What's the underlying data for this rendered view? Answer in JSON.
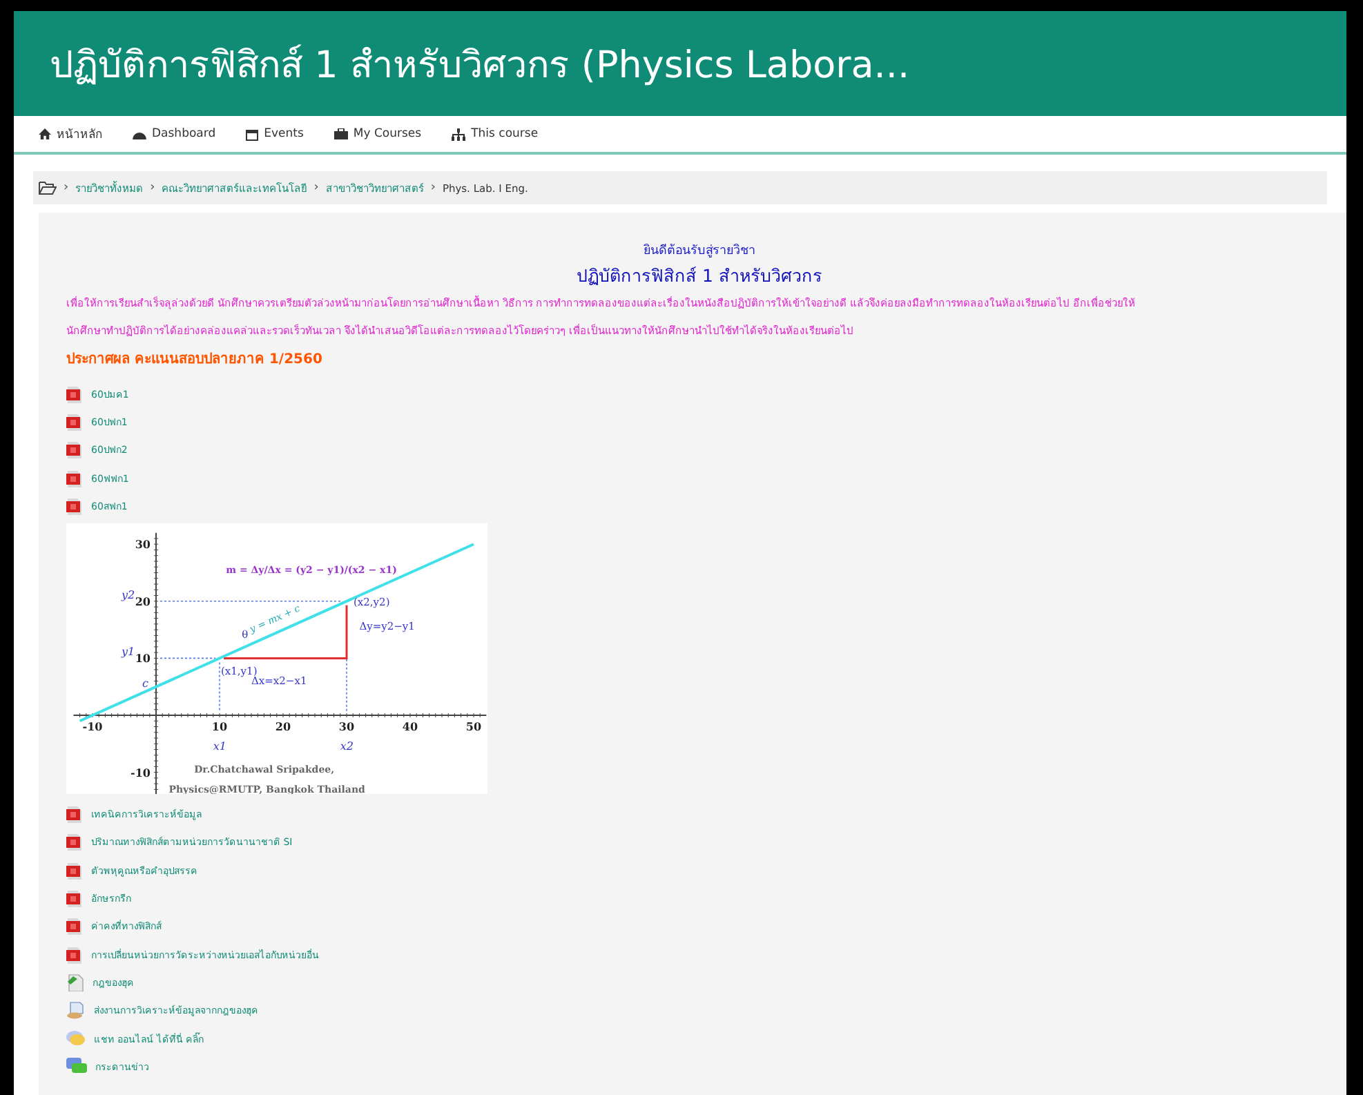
{
  "header": {
    "title": "ปฏิบัติการฟิสิกส์ 1 สำหรับวิศวกร (Physics Labora..."
  },
  "nav": [
    {
      "label": "หน้าหลัก",
      "kind": "home"
    },
    {
      "label": "Dashboard",
      "kind": "dashboard"
    },
    {
      "label": "Events",
      "kind": "calendar"
    },
    {
      "label": "My Courses",
      "kind": "briefcase"
    },
    {
      "label": "This course",
      "kind": "sitemap"
    }
  ],
  "breadcrumb": {
    "separator": "›",
    "items": [
      "รายวิชาทั้งหมด",
      "คณะวิทยาศาสตร์และเทคโนโลยี",
      "สาขาวิชาวิทยาศาสตร์",
      "Phys. Lab. I Eng."
    ]
  },
  "welcome": "ยินดีต้อนรับสู่รายวิชา",
  "course_title": "ปฏิบัติการฟิสิกส์ 1 สำหรับวิศวกร",
  "intro": "เพื่อให้การเรียนสำเร็จลุล่วงด้วยดี นักศึกษาควรเตรียมตัวล่วงหน้ามาก่อนโดยการอ่านศึกษาเนื้อหา วิธีการ การทำการทดลองของแต่ละเรื่องในหนังสือปฏิบัติการให้เข้าใจอย่างดี แล้วจึงค่อยลงมือทำการทดลองในห้องเรียนต่อไป อีกเพื่อช่วยให้นักศึกษาทำปฏิบัติการได้อย่างคล่องแคล่วและรวดเร็วทันเวลา จึงได้นำเสนอวิดีโอแต่ละการทดลองไว้โดยคร่าวๆ เพื่อเป็นแนวทางให้นักศึกษานำไปใช้ทำได้จริงในห้องเรียนต่อไป",
  "announcement": "ประกาศผล คะแนนสอบปลายภาค 1/2560",
  "files": [
    {
      "label": "60ปมค1",
      "kind": "pdf"
    },
    {
      "label": "60ปฟก1",
      "kind": "pdf"
    },
    {
      "label": "60ปฟก2",
      "kind": "pdf"
    },
    {
      "label": "60ฟฟก1",
      "kind": "pdf"
    },
    {
      "label": "60สฟก1",
      "kind": "pdf"
    }
  ],
  "figure": {
    "chart_data": {
      "type": "line",
      "x": [
        -12,
        50
      ],
      "series": [
        {
          "name": "y = mx + c",
          "color": "#40e0e8",
          "values": [
            -1,
            30
          ]
        }
      ],
      "xlim": [
        -13,
        52
      ],
      "ylim": [
        -14,
        32
      ],
      "xticks": [
        -10,
        10,
        20,
        30,
        40,
        50
      ],
      "yticks": [
        -10,
        10,
        20,
        30
      ],
      "annotations": [
        "(x1,y1)",
        "(x2,y2)",
        "m = Δy/Δx = (y2 − y1)/(x2 − x1)",
        "Δy=y2−y1",
        "Δx=x2−x1",
        "θ",
        "y2",
        "y1",
        "c",
        "x1",
        "x2",
        "Dr.Chatchawal Sripakdee,",
        "Physics@RMUTP, Bangkok Thailand"
      ]
    }
  },
  "resources": [
    {
      "label": "เทคนิคการวิเคราะห์ข้อมูล",
      "kind": "pdf"
    },
    {
      "label": "ปริมาณทางฟิสิกส์ตามหน่วยการวัดนานาชาติ SI",
      "kind": "pdf"
    },
    {
      "label": "ตัวพหุคูณหรือคำอุปสรรค",
      "kind": "pdf"
    },
    {
      "label": "อักษรกรีก",
      "kind": "pdf"
    },
    {
      "label": "ค่าคงที่ทางฟิสิกส์",
      "kind": "pdf"
    },
    {
      "label": "การเปลี่ยนหน่วยการวัดระหว่างหน่วยเอสไอกับหน่วยอื่น",
      "kind": "pdf"
    },
    {
      "label": "กฎของฮุค",
      "kind": "page"
    },
    {
      "label": "ส่งงานการวิเคราะห์ข้อมูลจากกฎของฮุค",
      "kind": "assignment"
    },
    {
      "label": "แชท ออนไลน์ ได้ที่นี่ คลิ๊ก",
      "kind": "chat"
    },
    {
      "label": "กระดานข่าว",
      "kind": "forum"
    }
  ]
}
